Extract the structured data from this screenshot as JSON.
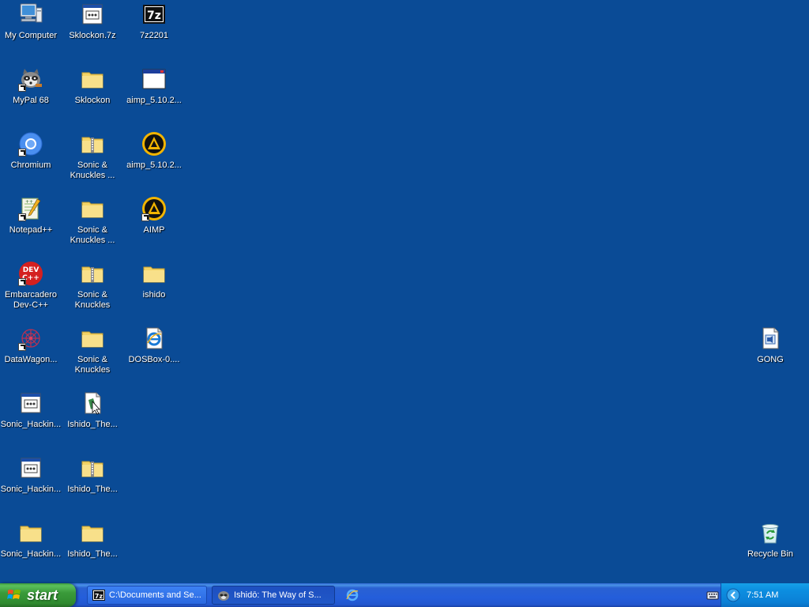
{
  "desktop": {
    "icons": [
      {
        "label": "My Computer"
      },
      {
        "label": "MyPal 68"
      },
      {
        "label": "Chromium"
      },
      {
        "label": "Notepad++"
      },
      {
        "label": "Embarcadero\nDev-C++"
      },
      {
        "label": "DataWagon..."
      },
      {
        "label": "Sonic_Hackin..."
      },
      {
        "label": "Sonic_Hackin..."
      },
      {
        "label": "Sonic_Hackin..."
      },
      {
        "label": "Sklockon.7z"
      },
      {
        "label": "Sklockon"
      },
      {
        "label": "Sonic &\nKnuckles ..."
      },
      {
        "label": "Sonic &\nKnuckles ..."
      },
      {
        "label": "Sonic &\nKnuckles"
      },
      {
        "label": "Sonic &\nKnuckles"
      },
      {
        "label": "Ishido_The..."
      },
      {
        "label": "Ishido_The..."
      },
      {
        "label": "Ishido_The..."
      },
      {
        "label": "7z2201"
      },
      {
        "label": "aimp_5.10.2..."
      },
      {
        "label": "aimp_5.10.2..."
      },
      {
        "label": "AIMP"
      },
      {
        "label": "ishido"
      },
      {
        "label": "DOSBox-0...."
      },
      {
        "label": "GONG"
      },
      {
        "label": "Recycle Bin"
      }
    ]
  },
  "taskbar": {
    "start_label": "start",
    "tasks": [
      {
        "label": "C:\\Documents and Se..."
      },
      {
        "label": "Ishidō: The Way of S..."
      }
    ],
    "clock": "7:51 AM"
  },
  "colors": {
    "desktop_bg": "#0a4b96",
    "taskbar_blue": "#245edb",
    "start_green": "#3a9b3a",
    "tray_blue": "#0b80d6"
  }
}
